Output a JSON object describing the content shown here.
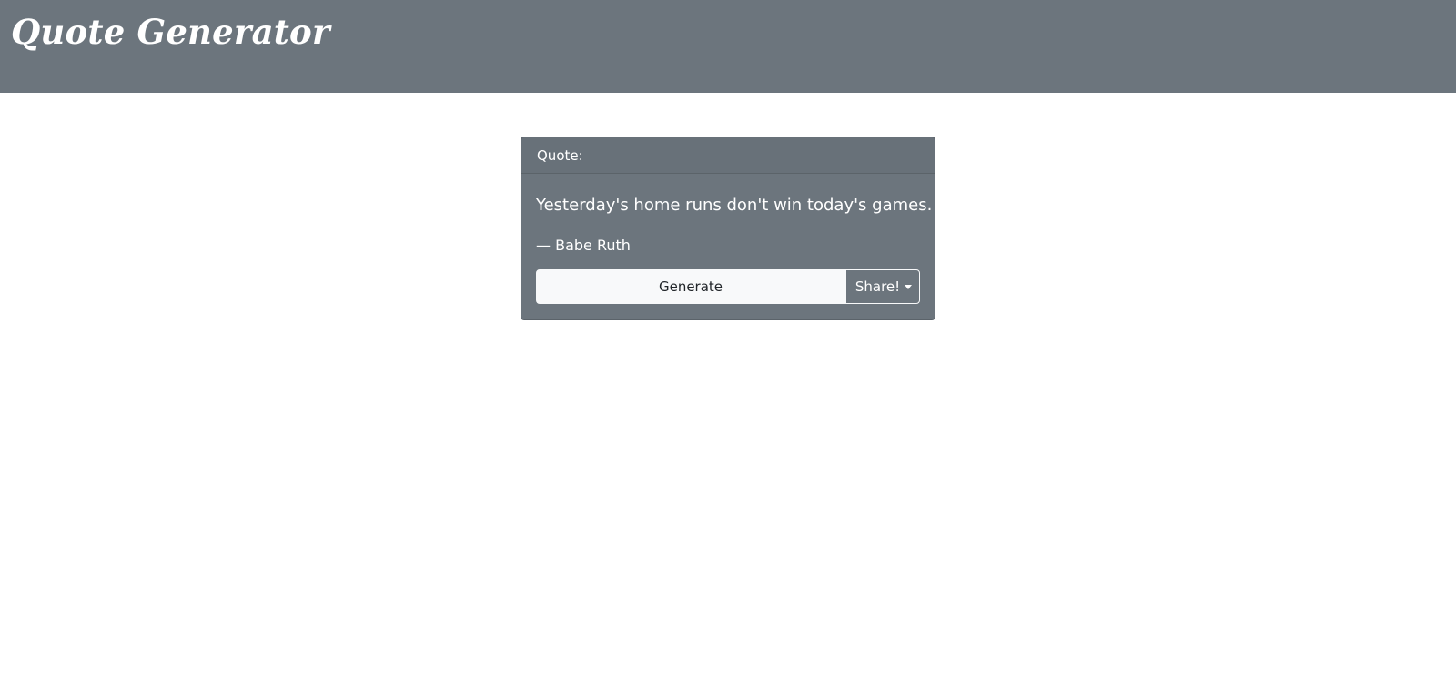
{
  "header": {
    "title": "Quote Generator"
  },
  "card": {
    "header_label": "Quote:",
    "quote_text": "Yesterday's home runs don't win today's games.",
    "author": "— Babe Ruth"
  },
  "actions": {
    "generate_label": "Generate",
    "share_label": "Share!",
    "share_icon": "caret-down-icon"
  },
  "colors": {
    "header_bg": "#6c757d",
    "card_bg": "#6c757d",
    "button_light": "#f8f9fa",
    "text_light": "#ffffff"
  }
}
